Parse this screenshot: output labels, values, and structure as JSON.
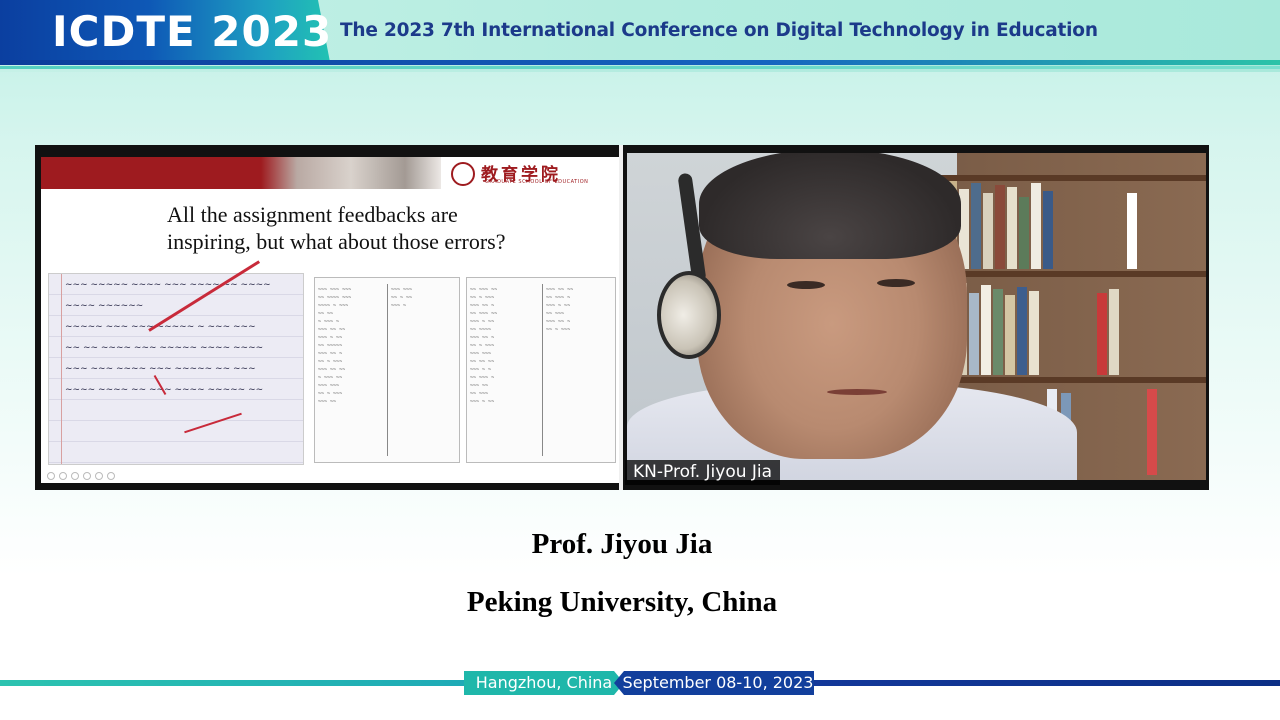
{
  "header": {
    "logo_text": "ICDTE 2023",
    "subtitle": "The 2023 7th International Conference on Digital Technology in Education"
  },
  "video": {
    "shared_slide": {
      "school_name": "教育学院",
      "school_name_en": "GRADUATE SCHOOL OF EDUCATION",
      "title_line1": "All the assignment feedbacks are",
      "title_line2": "inspiring, but what about those errors?"
    },
    "participant_label": "KN-Prof. Jiyou Jia"
  },
  "speaker": {
    "name": "Prof. Jiyou Jia",
    "affiliation": "Peking University, China"
  },
  "footer": {
    "location": "Hangzhou, China",
    "dates": "September 08-10, 2023"
  },
  "colors": {
    "brand_blue": "#0e4fb0",
    "brand_teal": "#22c2b3",
    "slide_red": "#9e1b1f"
  },
  "icons": [
    "school-seal-icon"
  ]
}
